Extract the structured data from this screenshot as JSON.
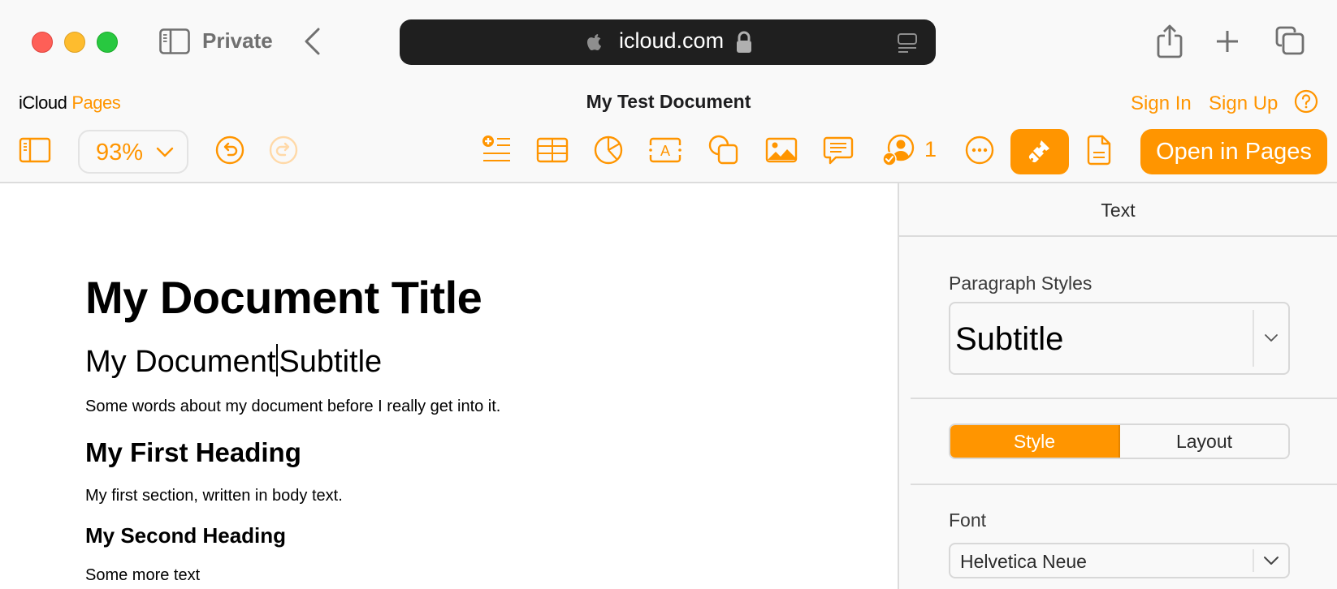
{
  "browser": {
    "mode_label": "Private",
    "url": "icloud.com",
    "icons": {
      "close": "traffic-light-close",
      "minimize": "traffic-light-minimize",
      "maximize": "traffic-light-maximize",
      "sidebar": "sidebar-icon",
      "back": "chevron-left-icon",
      "apple": "apple-logo-icon",
      "lock": "lock-icon",
      "reader": "reader-mode-icon",
      "share": "share-icon",
      "new_tab": "plus-icon",
      "tab_overview": "tabs-icon"
    }
  },
  "app": {
    "brand_primary": "iCloud",
    "brand_secondary": "Pages",
    "document_title": "My Test Document",
    "sign_in": "Sign In",
    "sign_up": "Sign Up",
    "accent_color": "#ff9500"
  },
  "toolbar": {
    "zoom_level": "93%",
    "collaborator_count": "1",
    "open_in_pages": "Open in Pages",
    "buttons": [
      {
        "name": "sidebar",
        "icon": "sidebar-icon"
      },
      {
        "name": "undo",
        "icon": "undo-icon"
      },
      {
        "name": "redo",
        "icon": "redo-icon",
        "disabled": true
      },
      {
        "name": "insert",
        "icon": "insert-list-icon"
      },
      {
        "name": "table",
        "icon": "table-icon"
      },
      {
        "name": "chart",
        "icon": "pie-chart-icon"
      },
      {
        "name": "text-box",
        "icon": "text-box-icon"
      },
      {
        "name": "shape",
        "icon": "shape-icon"
      },
      {
        "name": "media",
        "icon": "image-icon"
      },
      {
        "name": "comment",
        "icon": "comment-icon"
      },
      {
        "name": "collaborate",
        "icon": "collaborate-icon"
      },
      {
        "name": "more",
        "icon": "more-icon"
      },
      {
        "name": "format",
        "icon": "paintbrush-icon",
        "active": true
      },
      {
        "name": "document",
        "icon": "document-icon"
      }
    ]
  },
  "document": {
    "title": "My Document Title",
    "subtitle_before_caret": "My Document",
    "subtitle_after_caret": "Subtitle",
    "intro": "Some words about my document before I really get into it.",
    "heading1": "My First Heading",
    "body1": "My first section, written in body text.",
    "heading2": "My Second Heading",
    "body2": "Some more text"
  },
  "inspector": {
    "header": "Text",
    "paragraph_styles_label": "Paragraph Styles",
    "paragraph_style_value": "Subtitle",
    "tabs": [
      {
        "label": "Style",
        "active": true
      },
      {
        "label": "Layout",
        "active": false
      }
    ],
    "font_label": "Font",
    "font_value": "Helvetica Neue"
  }
}
